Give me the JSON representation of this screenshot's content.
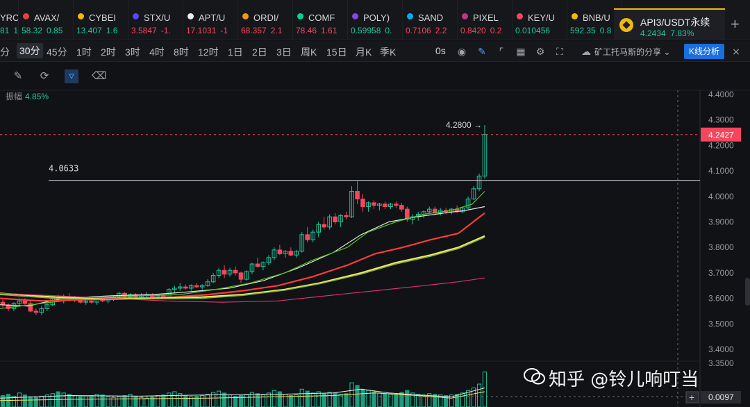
{
  "tickers": [
    {
      "symbol": "YRO",
      "price": "81",
      "change": "1.",
      "color": "#1fc59d",
      "icon": "",
      "first": true
    },
    {
      "symbol": "AVAX/",
      "price": "58.32",
      "change": "0.85",
      "color": "#1fc59d",
      "icon": "#e84142"
    },
    {
      "symbol": "CYBEI",
      "price": "13.407",
      "change": "1.6",
      "color": "#1fc59d",
      "icon": "#f0b90b"
    },
    {
      "symbol": "STX/U",
      "price": "3.5847",
      "change": "-1.",
      "color": "#f6465d",
      "icon": "#5546ff"
    },
    {
      "symbol": "APT/U",
      "price": "17.1031",
      "change": "-1",
      "color": "#f6465d",
      "icon": "#eaecef"
    },
    {
      "symbol": "ORDI/",
      "price": "68.357",
      "change": "2.1",
      "color": "#f6465d",
      "icon": "#f7931a"
    },
    {
      "symbol": "COMF",
      "price": "78.46",
      "change": "1.61",
      "color": "#f6465d",
      "icon": "#00d395"
    },
    {
      "symbol": "POLY)",
      "price": "0.59958",
      "change": "0.",
      "color": "#1fc59d",
      "icon": "#8247e5"
    },
    {
      "symbol": "SAND",
      "price": "0.7106",
      "change": "2.2",
      "color": "#f6465d",
      "icon": "#04adef"
    },
    {
      "symbol": "PIXEL",
      "price": "0.8420",
      "change": "0.2",
      "color": "#f6465d",
      "icon": "#c13584"
    },
    {
      "symbol": "KEY/U",
      "price": "0.010456",
      "change": "",
      "color": "#1fc59d",
      "icon": "#f6465d"
    },
    {
      "symbol": "BNB/U",
      "price": "592.35",
      "change": "0.8",
      "color": "#1fc59d",
      "icon": "#f0b90b"
    }
  ],
  "active_tab": {
    "symbol": "API3/USDT永续",
    "price": "4.2434",
    "change": "7.83%"
  },
  "plus_label": "+",
  "timeframes": [
    {
      "label": "分",
      "left": 0
    },
    {
      "label": "30分",
      "left": 24,
      "selected": true
    },
    {
      "label": "45分",
      "left": 67
    },
    {
      "label": "1时",
      "left": 110
    },
    {
      "label": "2时",
      "left": 145
    },
    {
      "label": "3时",
      "left": 180
    },
    {
      "label": "4时",
      "left": 215
    },
    {
      "label": "8时",
      "left": 250
    },
    {
      "label": "12时",
      "left": 285
    },
    {
      "label": "1日",
      "left": 328
    },
    {
      "label": "2日",
      "left": 363
    },
    {
      "label": "3日",
      "left": 398
    },
    {
      "label": "周K",
      "left": 433
    },
    {
      "label": "15日",
      "left": 470
    },
    {
      "label": "月K",
      "left": 512
    },
    {
      "label": "季K",
      "left": 547
    }
  ],
  "toolbar": {
    "mode": "0s",
    "share_label": "矿工托马斯的分享",
    "kline_label": "K线分析",
    "icons": [
      "camera-icon",
      "pen-icon",
      "crop-icon",
      "layout-icon",
      "settings-icon",
      "fullscreen-icon"
    ]
  },
  "drawing_tools": [
    "edit-note-icon",
    "magnet-icon",
    "filter-icon",
    "trash-icon"
  ],
  "amplitude": {
    "label": "振幅",
    "value": "4.85%"
  },
  "watermark": "知乎 @铃儿响叮当",
  "chart_data": {
    "type": "candlestick",
    "y_ticks": [
      "4.4000",
      "4.3000",
      "4.2000",
      "4.1000",
      "4.0000",
      "3.9000",
      "3.8000",
      "3.7000",
      "3.6000",
      "3.5000",
      "3.4000",
      "3.3500"
    ],
    "ylim": [
      3.35,
      4.4
    ],
    "current_price": 4.2427,
    "current_price_label": "4.2427",
    "volume_label": "0.0097",
    "horizontal_line": {
      "value": 4.0633,
      "label": "4.0633"
    },
    "high_marker": {
      "value": 4.28,
      "label": "4.2800 →"
    },
    "candles": [
      [
        3.585,
        3.595,
        3.565,
        3.575
      ],
      [
        3.575,
        3.58,
        3.55,
        3.56
      ],
      [
        3.56,
        3.585,
        3.55,
        3.58
      ],
      [
        3.58,
        3.6,
        3.57,
        3.59
      ],
      [
        3.59,
        3.6,
        3.575,
        3.58
      ],
      [
        3.58,
        3.59,
        3.545,
        3.55
      ],
      [
        3.55,
        3.56,
        3.535,
        3.545
      ],
      [
        3.545,
        3.57,
        3.535,
        3.56
      ],
      [
        3.56,
        3.585,
        3.55,
        3.575
      ],
      [
        3.575,
        3.61,
        3.57,
        3.6
      ],
      [
        3.6,
        3.615,
        3.585,
        3.59
      ],
      [
        3.59,
        3.615,
        3.58,
        3.605
      ],
      [
        3.605,
        3.62,
        3.59,
        3.595
      ],
      [
        3.595,
        3.61,
        3.585,
        3.6
      ],
      [
        3.6,
        3.605,
        3.58,
        3.585
      ],
      [
        3.585,
        3.6,
        3.575,
        3.59
      ],
      [
        3.59,
        3.6,
        3.58,
        3.585
      ],
      [
        3.585,
        3.6,
        3.575,
        3.595
      ],
      [
        3.595,
        3.605,
        3.585,
        3.59
      ],
      [
        3.59,
        3.6,
        3.58,
        3.595
      ],
      [
        3.595,
        3.61,
        3.59,
        3.605
      ],
      [
        3.605,
        3.625,
        3.595,
        3.62
      ],
      [
        3.62,
        3.625,
        3.6,
        3.605
      ],
      [
        3.605,
        3.62,
        3.6,
        3.615
      ],
      [
        3.615,
        3.62,
        3.6,
        3.605
      ],
      [
        3.605,
        3.62,
        3.6,
        3.61
      ],
      [
        3.61,
        3.625,
        3.605,
        3.615
      ],
      [
        3.615,
        3.62,
        3.6,
        3.605
      ],
      [
        3.605,
        3.615,
        3.595,
        3.61
      ],
      [
        3.61,
        3.62,
        3.6,
        3.605
      ],
      [
        3.605,
        3.64,
        3.6,
        3.635
      ],
      [
        3.635,
        3.65,
        3.62,
        3.64
      ],
      [
        3.64,
        3.66,
        3.63,
        3.645
      ],
      [
        3.645,
        3.655,
        3.635,
        3.64
      ],
      [
        3.64,
        3.655,
        3.63,
        3.65
      ],
      [
        3.65,
        3.66,
        3.64,
        3.645
      ],
      [
        3.645,
        3.655,
        3.635,
        3.65
      ],
      [
        3.65,
        3.675,
        3.645,
        3.665
      ],
      [
        3.665,
        3.7,
        3.66,
        3.69
      ],
      [
        3.69,
        3.72,
        3.68,
        3.71
      ],
      [
        3.71,
        3.73,
        3.68,
        3.695
      ],
      [
        3.695,
        3.72,
        3.685,
        3.71
      ],
      [
        3.71,
        3.725,
        3.69,
        3.7
      ],
      [
        3.7,
        3.705,
        3.66,
        3.675
      ],
      [
        3.675,
        3.71,
        3.67,
        3.705
      ],
      [
        3.705,
        3.74,
        3.695,
        3.735
      ],
      [
        3.735,
        3.76,
        3.72,
        3.725
      ],
      [
        3.725,
        3.745,
        3.71,
        3.74
      ],
      [
        3.74,
        3.77,
        3.73,
        3.76
      ],
      [
        3.76,
        3.8,
        3.75,
        3.79
      ],
      [
        3.79,
        3.81,
        3.77,
        3.775
      ],
      [
        3.775,
        3.79,
        3.76,
        3.785
      ],
      [
        3.785,
        3.8,
        3.765,
        3.77
      ],
      [
        3.77,
        3.79,
        3.76,
        3.785
      ],
      [
        3.785,
        3.86,
        3.78,
        3.85
      ],
      [
        3.85,
        3.88,
        3.82,
        3.83
      ],
      [
        3.83,
        3.87,
        3.82,
        3.86
      ],
      [
        3.86,
        3.9,
        3.84,
        3.89
      ],
      [
        3.89,
        3.92,
        3.87,
        3.88
      ],
      [
        3.88,
        3.93,
        3.87,
        3.92
      ],
      [
        3.92,
        3.935,
        3.89,
        3.9
      ],
      [
        3.9,
        3.93,
        3.88,
        3.925
      ],
      [
        3.925,
        3.94,
        3.91,
        3.92
      ],
      [
        3.92,
        4.04,
        3.915,
        4.02
      ],
      [
        4.02,
        4.06,
        3.97,
        3.99
      ],
      [
        3.99,
        4.01,
        3.94,
        3.96
      ],
      [
        3.96,
        3.98,
        3.94,
        3.975
      ],
      [
        3.975,
        3.985,
        3.95,
        3.965
      ],
      [
        3.965,
        3.975,
        3.945,
        3.97
      ],
      [
        3.97,
        3.98,
        3.95,
        3.96
      ],
      [
        3.96,
        3.975,
        3.95,
        3.97
      ],
      [
        3.97,
        3.98,
        3.955,
        3.965
      ],
      [
        3.965,
        3.975,
        3.94,
        3.95
      ],
      [
        3.95,
        3.96,
        3.9,
        3.91
      ],
      [
        3.91,
        3.93,
        3.89,
        3.92
      ],
      [
        3.92,
        3.94,
        3.905,
        3.93
      ],
      [
        3.93,
        3.945,
        3.915,
        3.94
      ],
      [
        3.94,
        3.96,
        3.93,
        3.95
      ],
      [
        3.95,
        3.96,
        3.93,
        3.935
      ],
      [
        3.935,
        3.955,
        3.925,
        3.945
      ],
      [
        3.945,
        3.955,
        3.93,
        3.94
      ],
      [
        3.94,
        3.955,
        3.93,
        3.95
      ],
      [
        3.95,
        3.965,
        3.935,
        3.94
      ],
      [
        3.94,
        3.96,
        3.935,
        3.955
      ],
      [
        3.955,
        4.0,
        3.95,
        3.99
      ],
      [
        3.99,
        4.04,
        3.985,
        4.03
      ],
      [
        4.03,
        4.09,
        4.02,
        4.08
      ],
      [
        4.08,
        4.28,
        4.07,
        4.2427
      ]
    ],
    "ma_lines": [
      {
        "color": "#e6e6e6",
        "width": 1.2,
        "points": [
          [
            0,
            3.575
          ],
          [
            40,
            3.57
          ],
          [
            90,
            3.6
          ],
          [
            160,
            3.61
          ],
          [
            220,
            3.615
          ],
          [
            270,
            3.625
          ],
          [
            330,
            3.64
          ],
          [
            380,
            3.67
          ],
          [
            430,
            3.72
          ],
          [
            480,
            3.78
          ],
          [
            520,
            3.85
          ],
          [
            560,
            3.9
          ],
          [
            600,
            3.92
          ],
          [
            640,
            3.935
          ],
          [
            670,
            3.945
          ],
          [
            698,
            3.96
          ]
        ]
      },
      {
        "color": "#52c41a",
        "width": 1.2,
        "points": [
          [
            0,
            3.56
          ],
          [
            60,
            3.58
          ],
          [
            120,
            3.6
          ],
          [
            200,
            3.61
          ],
          [
            260,
            3.615
          ],
          [
            310,
            3.635
          ],
          [
            360,
            3.66
          ],
          [
            410,
            3.7
          ],
          [
            450,
            3.75
          ],
          [
            500,
            3.8
          ],
          [
            530,
            3.86
          ],
          [
            570,
            3.9
          ],
          [
            610,
            3.93
          ],
          [
            650,
            3.945
          ],
          [
            680,
            3.97
          ],
          [
            698,
            4.02
          ]
        ]
      },
      {
        "color": "#ff3b3b",
        "width": 2.2,
        "points": [
          [
            0,
            3.6
          ],
          [
            60,
            3.59
          ],
          [
            120,
            3.595
          ],
          [
            190,
            3.6
          ],
          [
            250,
            3.605
          ],
          [
            300,
            3.615
          ],
          [
            350,
            3.63
          ],
          [
            400,
            3.65
          ],
          [
            450,
            3.685
          ],
          [
            500,
            3.73
          ],
          [
            540,
            3.775
          ],
          [
            580,
            3.8
          ],
          [
            620,
            3.83
          ],
          [
            660,
            3.855
          ],
          [
            698,
            3.935
          ]
        ]
      },
      {
        "color": "#f5e663",
        "width": 2.2,
        "points": [
          [
            0,
            3.62
          ],
          [
            80,
            3.605
          ],
          [
            150,
            3.6
          ],
          [
            220,
            3.6
          ],
          [
            290,
            3.605
          ],
          [
            350,
            3.615
          ],
          [
            410,
            3.635
          ],
          [
            460,
            3.66
          ],
          [
            520,
            3.7
          ],
          [
            570,
            3.74
          ],
          [
            620,
            3.77
          ],
          [
            660,
            3.8
          ],
          [
            698,
            3.845
          ]
        ]
      },
      {
        "color": "#7cb342",
        "width": 1.5,
        "points": [
          [
            0,
            3.615
          ],
          [
            80,
            3.6
          ],
          [
            150,
            3.595
          ],
          [
            220,
            3.598
          ],
          [
            290,
            3.6
          ],
          [
            350,
            3.612
          ],
          [
            410,
            3.632
          ],
          [
            460,
            3.657
          ],
          [
            520,
            3.695
          ],
          [
            570,
            3.735
          ],
          [
            620,
            3.765
          ],
          [
            660,
            3.795
          ],
          [
            698,
            3.84
          ]
        ]
      },
      {
        "color": "#d6336c",
        "width": 1.2,
        "points": [
          [
            0,
            3.62
          ],
          [
            80,
            3.61
          ],
          [
            160,
            3.6
          ],
          [
            240,
            3.59
          ],
          [
            320,
            3.585
          ],
          [
            400,
            3.59
          ],
          [
            470,
            3.61
          ],
          [
            540,
            3.63
          ],
          [
            610,
            3.65
          ],
          [
            660,
            3.665
          ],
          [
            698,
            3.68
          ]
        ]
      }
    ],
    "volume_bars": [
      18,
      20,
      17,
      22,
      19,
      16,
      15,
      17,
      19,
      21,
      24,
      22,
      20,
      18,
      17,
      16,
      18,
      20,
      19,
      17,
      15,
      16,
      18,
      20,
      17,
      15,
      14,
      16,
      18,
      19,
      22,
      24,
      21,
      18,
      16,
      17,
      18,
      20,
      23,
      25,
      22,
      19,
      17,
      18,
      20,
      23,
      21,
      19,
      22,
      26,
      24,
      20,
      18,
      19,
      28,
      25,
      22,
      24,
      21,
      23,
      22,
      20,
      21,
      38,
      34,
      28,
      26,
      24,
      22,
      21,
      20,
      19,
      23,
      26,
      22,
      20,
      19,
      21,
      20,
      19,
      18,
      19,
      20,
      22,
      26,
      30,
      36,
      55
    ],
    "volume_lines": [
      {
        "color": "#e6e6e6",
        "points": [
          [
            0,
            14
          ],
          [
            100,
            18
          ],
          [
            200,
            17
          ],
          [
            300,
            19
          ],
          [
            400,
            20
          ],
          [
            480,
            22
          ],
          [
            520,
            28
          ],
          [
            560,
            22
          ],
          [
            600,
            19
          ],
          [
            650,
            16
          ],
          [
            698,
            30
          ]
        ]
      },
      {
        "color": "#f5e663",
        "points": [
          [
            0,
            10
          ],
          [
            100,
            12
          ],
          [
            200,
            13
          ],
          [
            300,
            14
          ],
          [
            400,
            16
          ],
          [
            480,
            18
          ],
          [
            540,
            22
          ],
          [
            600,
            18
          ],
          [
            650,
            14
          ],
          [
            698,
            24
          ]
        ]
      }
    ]
  }
}
